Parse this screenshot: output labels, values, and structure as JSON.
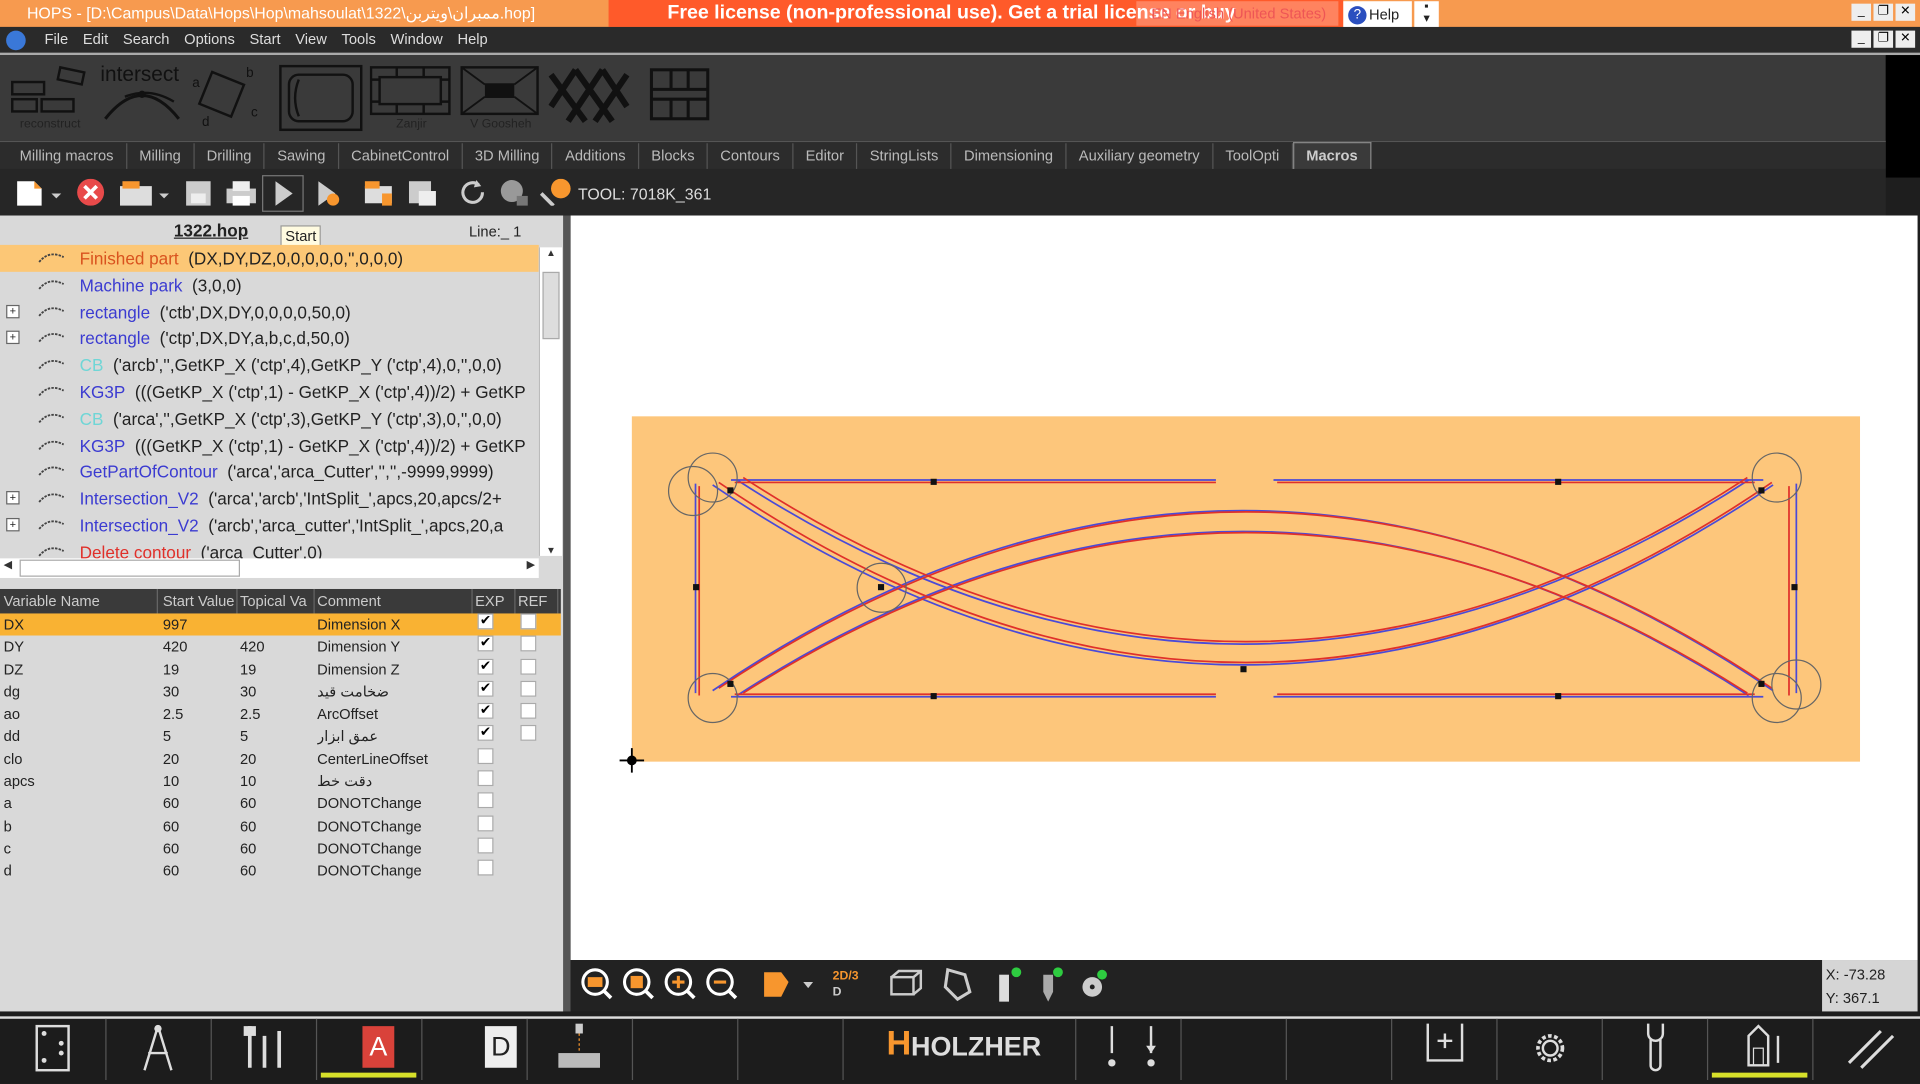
{
  "window": {
    "title": "HOPS - [D:\\Campus\\Data\\Hops\\Hop\\mahsoulat\\1322\\ممبران\\ویتربن.hop]",
    "license_banner": "Free license (non-professional use). Get a trial license or buy",
    "language": "EN English (United States)",
    "help_label": "Help"
  },
  "menu": [
    "File",
    "Edit",
    "Search",
    "Options",
    "Start",
    "View",
    "Tools",
    "Window",
    "Help"
  ],
  "ribbon": [
    {
      "name": "reconstruct",
      "label": "reconstruct"
    },
    {
      "name": "intersect",
      "label": "intersect"
    },
    {
      "name": "rotated-rect",
      "label": ""
    },
    {
      "name": "frame",
      "label": ""
    },
    {
      "name": "zanjir",
      "label": "Zanjir"
    },
    {
      "name": "v-goosheh",
      "label": "V Goosheh"
    },
    {
      "name": "lattice",
      "label": ""
    },
    {
      "name": "grid",
      "label": ""
    }
  ],
  "ribbon_intersect_text": "intersect",
  "tabs": [
    {
      "label": "Milling macros"
    },
    {
      "label": "Milling"
    },
    {
      "label": "Drilling"
    },
    {
      "label": "Sawing"
    },
    {
      "label": "CabinetControl"
    },
    {
      "label": "3D Milling"
    },
    {
      "label": "Additions"
    },
    {
      "label": "Blocks"
    },
    {
      "label": "Contours"
    },
    {
      "label": "Editor"
    },
    {
      "label": "StringLists"
    },
    {
      "label": "Dimensioning"
    },
    {
      "label": "Auxiliary geometry"
    },
    {
      "label": "ToolOpti"
    },
    {
      "label": "Macros",
      "active": true
    }
  ],
  "toolbar": {
    "tool_info": "TOOL: 7018K_361",
    "tooltip": "Start"
  },
  "tree": {
    "file_name": "1322.hop",
    "line_info": "Line:_ 1",
    "items": [
      {
        "name": "Finished part",
        "args": "(DX,DY,DZ,0,0,0,0,0,'',0,0,0)",
        "color": "#d9531e",
        "selected": true
      },
      {
        "name": "Machine park",
        "args": "(3,0,0)",
        "color": "#3b3bd1"
      },
      {
        "name": "rectangle",
        "args": "('ctb',DX,DY,0,0,0,0,50,0)",
        "color": "#3b3bd1",
        "expandable": true
      },
      {
        "name": "rectangle",
        "args": "('ctp',DX,DY,a,b,c,d,50,0)",
        "color": "#3b3bd1",
        "expandable": true
      },
      {
        "name": "CB",
        "args": "('arcb','',GetKP_X ('ctp',4),GetKP_Y ('ctp',4),0,'',0,0)",
        "color": "#6fd6d6"
      },
      {
        "name": "KG3P",
        "args": "(((GetKP_X ('ctp',1) - GetKP_X ('ctp',4))/2) + GetKP",
        "color": "#3b3bd1"
      },
      {
        "name": "CB",
        "args": "('arca','',GetKP_X ('ctp',3),GetKP_Y ('ctp',3),0,'',0,0)",
        "color": "#6fd6d6"
      },
      {
        "name": "KG3P",
        "args": "(((GetKP_X ('ctp',1) - GetKP_X ('ctp',4))/2) + GetKP",
        "color": "#3b3bd1"
      },
      {
        "name": "GetPartOfContour",
        "args": "('arca','arca_Cutter','','',-9999,9999)",
        "color": "#3b3bd1"
      },
      {
        "name": "Intersection_V2",
        "args": "('arca','arcb','IntSplit_',apcs,20,apcs/2+",
        "color": "#3b3bd1",
        "expandable": true
      },
      {
        "name": "Intersection_V2",
        "args": "('arcb','arca_cutter','IntSplit_',apcs,20,a",
        "color": "#3b3bd1",
        "expandable": true
      },
      {
        "name": "Delete contour",
        "args": "('arca_Cutter',0)",
        "color": "#e0302a"
      }
    ]
  },
  "variables": {
    "headers": [
      "Variable Name",
      "Start Value",
      "Topical Va",
      "Comment",
      "EXP",
      "REF"
    ],
    "rows": [
      {
        "name": "DX",
        "start": "997",
        "topical": "",
        "comment": "Dimension X",
        "exp": true,
        "ref": false,
        "selected": true
      },
      {
        "name": "DY",
        "start": "420",
        "topical": "420",
        "comment": "Dimension Y",
        "exp": true,
        "ref": false
      },
      {
        "name": "DZ",
        "start": "19",
        "topical": "19",
        "comment": "Dimension Z",
        "exp": true,
        "ref": false
      },
      {
        "name": "dg",
        "start": "30",
        "topical": "30",
        "comment": "ضخامت قید",
        "exp": true,
        "ref": false
      },
      {
        "name": "ao",
        "start": "2.5",
        "topical": "2.5",
        "comment": "ArcOffset",
        "exp": true,
        "ref": false
      },
      {
        "name": "dd",
        "start": "5",
        "topical": "5",
        "comment": "عمق ابزار",
        "exp": true,
        "ref": false
      },
      {
        "name": "clo",
        "start": "20",
        "topical": "20",
        "comment": "CenterLineOffset",
        "exp": false
      },
      {
        "name": "apcs",
        "start": "10",
        "topical": "10",
        "comment": "دقت خط",
        "exp": false
      },
      {
        "name": "a",
        "start": "60",
        "topical": "60",
        "comment": "DONOTChange",
        "exp": false
      },
      {
        "name": "b",
        "start": "60",
        "topical": "60",
        "comment": "DONOTChange",
        "exp": false
      },
      {
        "name": "c",
        "start": "60",
        "topical": "60",
        "comment": "DONOTChange",
        "exp": false
      },
      {
        "name": "d",
        "start": "60",
        "topical": "60",
        "comment": "DONOTChange",
        "exp": false
      }
    ]
  },
  "view_toolbar": {
    "view_mode": "2D/3D"
  },
  "coords": {
    "x": "X: -73.28",
    "y": "Y: 367.1"
  },
  "bottom": {
    "brand": "HOLZHER",
    "active_cells": [
      "A",
      "tool-height"
    ]
  },
  "colors": {
    "part": "#fdc67b",
    "contour_blue": "#4a4ad8",
    "contour_red": "#e0302a",
    "selected_row": "#f9b233",
    "accent": "#f79a4f"
  }
}
